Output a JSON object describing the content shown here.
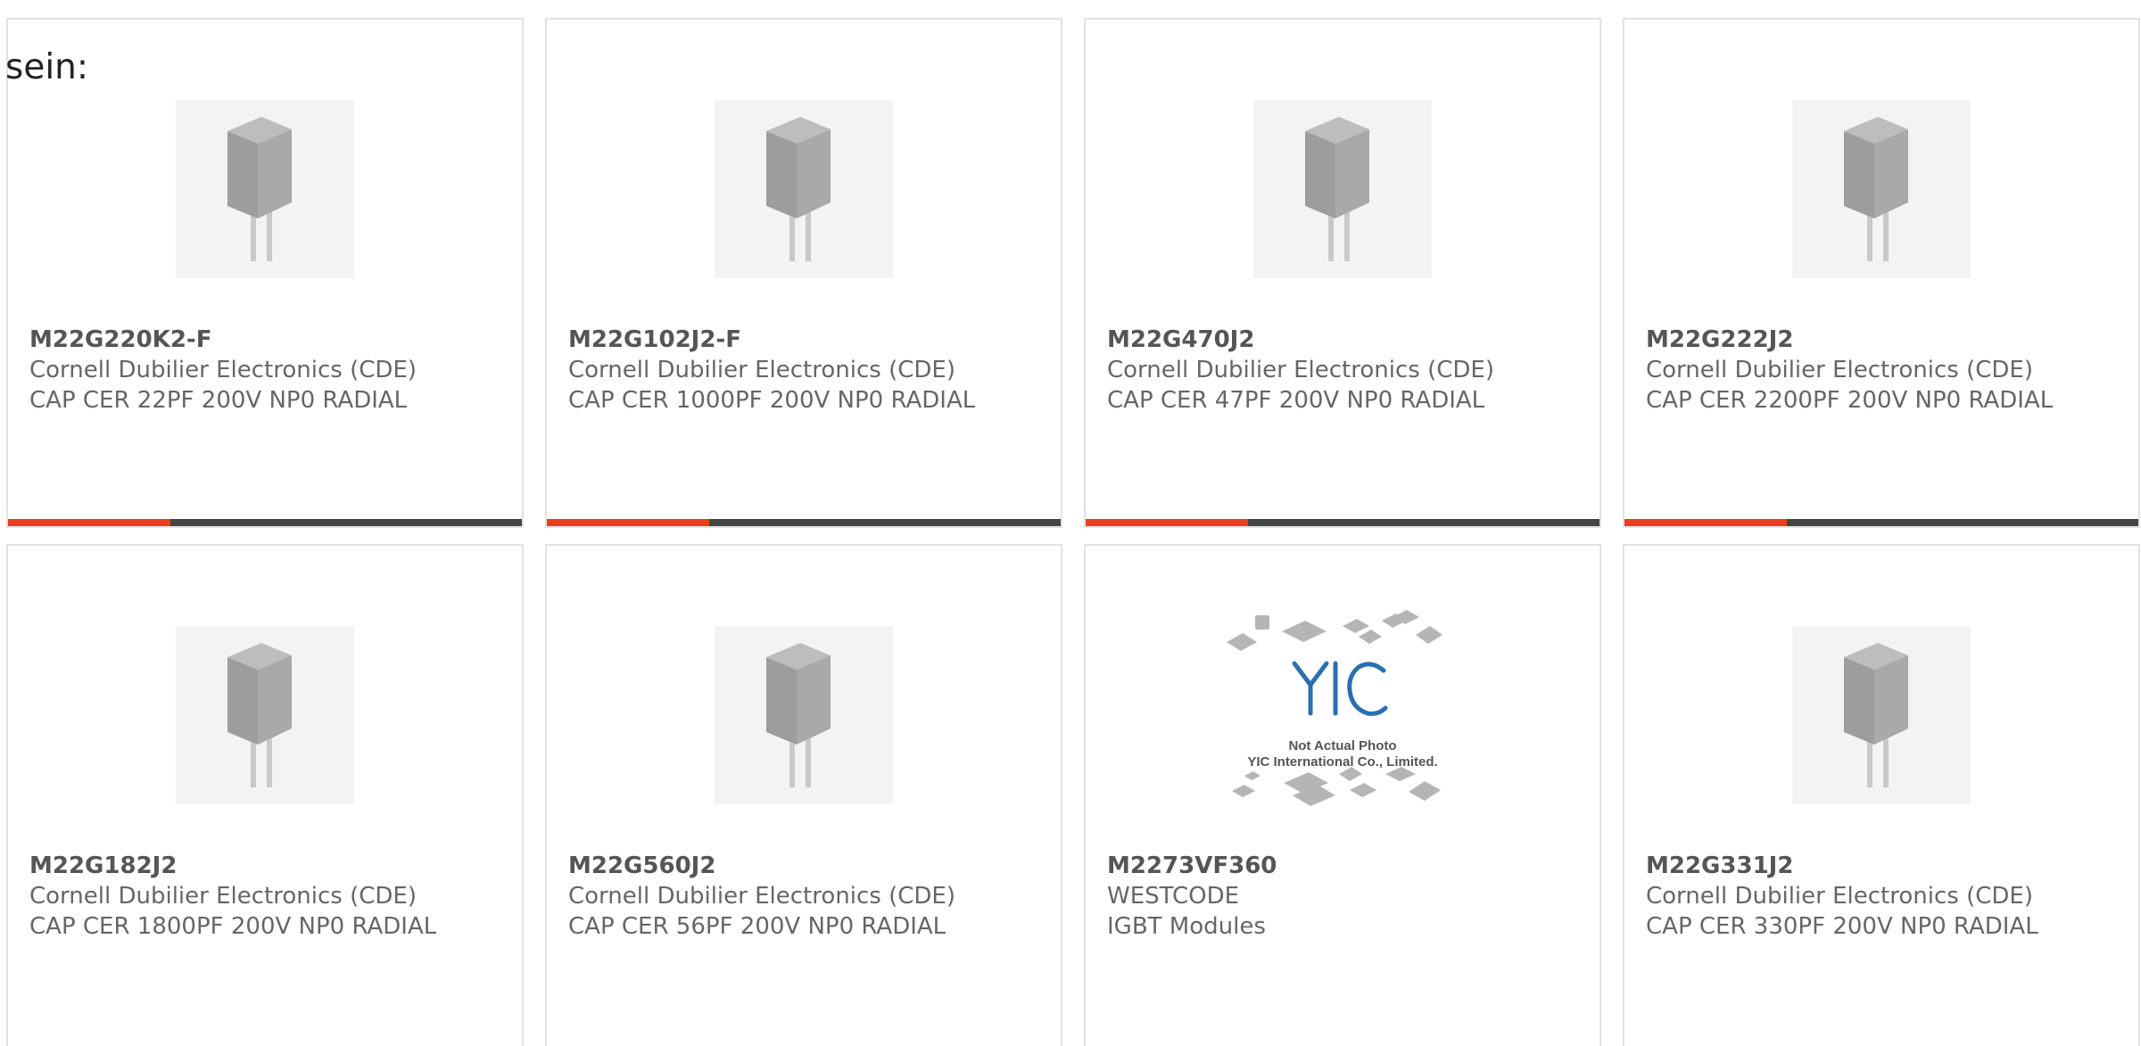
{
  "intro_text": "sein:",
  "colors": {
    "accent": "#e8401c",
    "bar": "#444444",
    "border": "#e2e2e2"
  },
  "products": [
    {
      "part": "M22G220K2-F",
      "maker": "Cornell Dubilier Electronics (CDE)",
      "desc": "CAP CER 22PF 200V NP0 RADIAL",
      "image": "capacitor",
      "has_bar": true
    },
    {
      "part": "M22G102J2-F",
      "maker": "Cornell Dubilier Electronics (CDE)",
      "desc": "CAP CER 1000PF 200V NP0 RADIAL",
      "image": "capacitor",
      "has_bar": true
    },
    {
      "part": "M22G470J2",
      "maker": "Cornell Dubilier Electronics (CDE)",
      "desc": "CAP CER 47PF 200V NP0 RADIAL",
      "image": "capacitor",
      "has_bar": true
    },
    {
      "part": "M22G222J2",
      "maker": "Cornell Dubilier Electronics (CDE)",
      "desc": "CAP CER 2200PF 200V NP0 RADIAL",
      "image": "capacitor",
      "has_bar": true
    },
    {
      "part": "M22G182J2",
      "maker": "Cornell Dubilier Electronics (CDE)",
      "desc": "CAP CER 1800PF 200V NP0 RADIAL",
      "image": "capacitor",
      "has_bar": false
    },
    {
      "part": "M22G560J2",
      "maker": "Cornell Dubilier Electronics (CDE)",
      "desc": "CAP CER 56PF 200V NP0 RADIAL",
      "image": "capacitor",
      "has_bar": false
    },
    {
      "part": "M2273VF360",
      "maker": "WESTCODE",
      "desc": "IGBT Modules",
      "image": "stock-photo",
      "image_logo": "YIC",
      "image_caption_1": "Not Actual Photo",
      "image_caption_2": "YIC International Co., Limited.",
      "has_bar": false
    },
    {
      "part": "M22G331J2",
      "maker": "Cornell Dubilier Electronics (CDE)",
      "desc": "CAP CER 330PF 200V NP0 RADIAL",
      "image": "capacitor",
      "has_bar": false
    }
  ]
}
